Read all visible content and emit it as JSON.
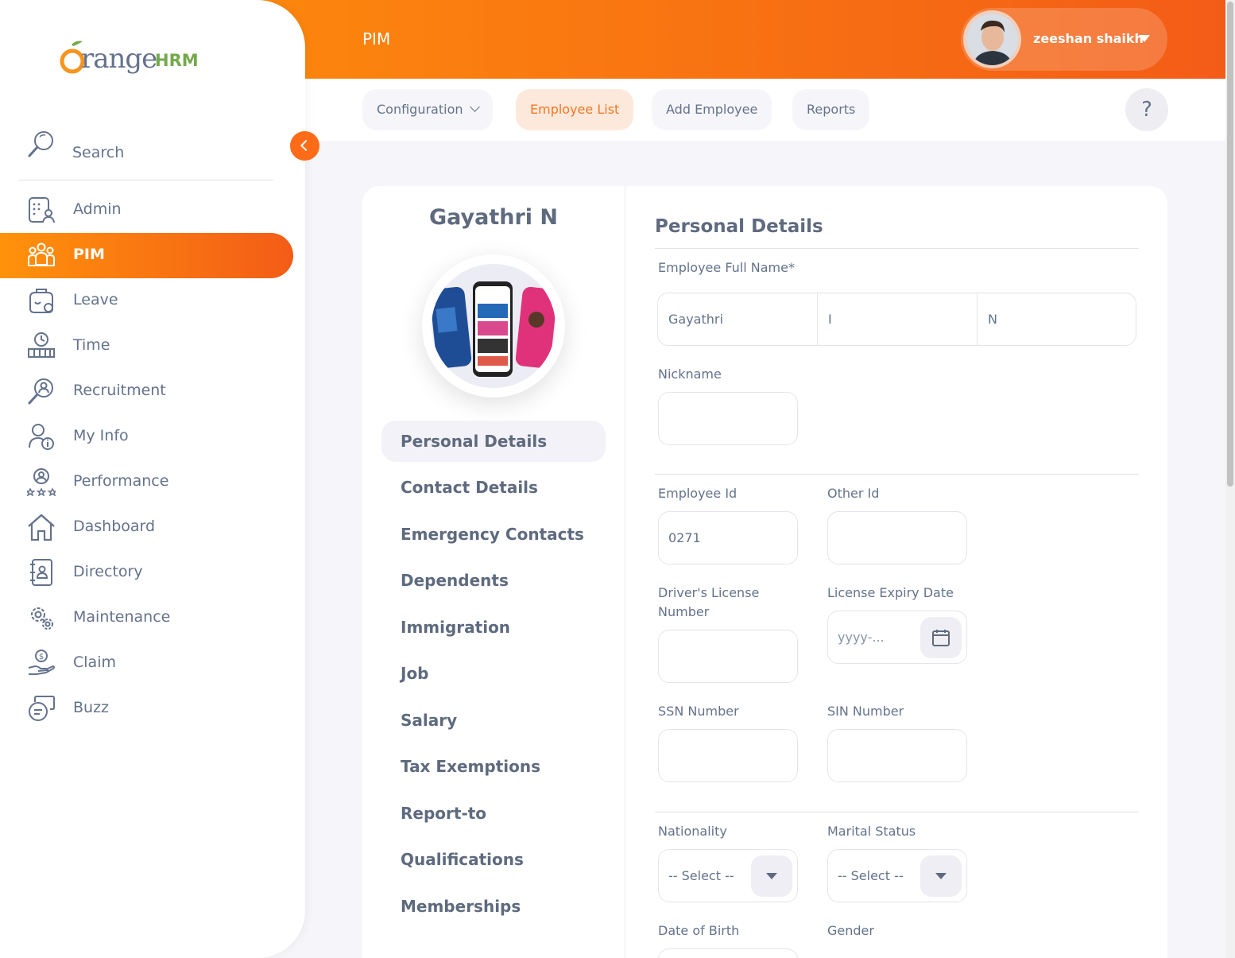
{
  "header": {
    "module_title": "PIM",
    "user_name": "zeeshan shaikh"
  },
  "subnav": {
    "configuration": "Configuration",
    "employee_list": "Employee List",
    "add_employee": "Add Employee",
    "reports": "Reports",
    "help": "?"
  },
  "sidebar": {
    "logo_text": "range",
    "logo_hrm": "HRM",
    "search_label": "Search",
    "items": [
      {
        "label": "Admin",
        "icon": "admin-icon"
      },
      {
        "label": "PIM",
        "icon": "pim-icon"
      },
      {
        "label": "Leave",
        "icon": "leave-icon"
      },
      {
        "label": "Time",
        "icon": "time-icon"
      },
      {
        "label": "Recruitment",
        "icon": "recruitment-icon"
      },
      {
        "label": "My Info",
        "icon": "my-info-icon"
      },
      {
        "label": "Performance",
        "icon": "performance-icon"
      },
      {
        "label": "Dashboard",
        "icon": "dashboard-icon"
      },
      {
        "label": "Directory",
        "icon": "directory-icon"
      },
      {
        "label": "Maintenance",
        "icon": "maintenance-icon"
      },
      {
        "label": "Claim",
        "icon": "claim-icon"
      },
      {
        "label": "Buzz",
        "icon": "buzz-icon"
      }
    ],
    "active_item": "PIM"
  },
  "employee": {
    "name": "Gayathri N",
    "tabs": [
      "Personal Details",
      "Contact Details",
      "Emergency Contacts",
      "Dependents",
      "Immigration",
      "Job",
      "Salary",
      "Tax Exemptions",
      "Report-to",
      "Qualifications",
      "Memberships"
    ],
    "active_tab": "Personal Details"
  },
  "form": {
    "title": "Personal Details",
    "full_name_label": "Employee Full Name*",
    "first_name": "Gayathri",
    "middle_name": "I",
    "last_name": "N",
    "nickname_label": "Nickname",
    "nickname": "",
    "employee_id_label": "Employee Id",
    "employee_id": "0271",
    "other_id_label": "Other Id",
    "other_id": "",
    "license_label": "Driver's License Number",
    "license_number": "",
    "license_expiry_label": "License Expiry Date",
    "license_expiry_placeholder": "yyyy-...",
    "ssn_label": "SSN Number",
    "ssn": "",
    "sin_label": "SIN Number",
    "sin": "",
    "nationality_label": "Nationality",
    "nationality_value": "-- Select --",
    "marital_label": "Marital Status",
    "marital_value": "-- Select --",
    "dob_label": "Date of Birth",
    "gender_label": "Gender"
  },
  "colors": {
    "brand_orange": "#ff7b1d",
    "text": "#64728c"
  }
}
